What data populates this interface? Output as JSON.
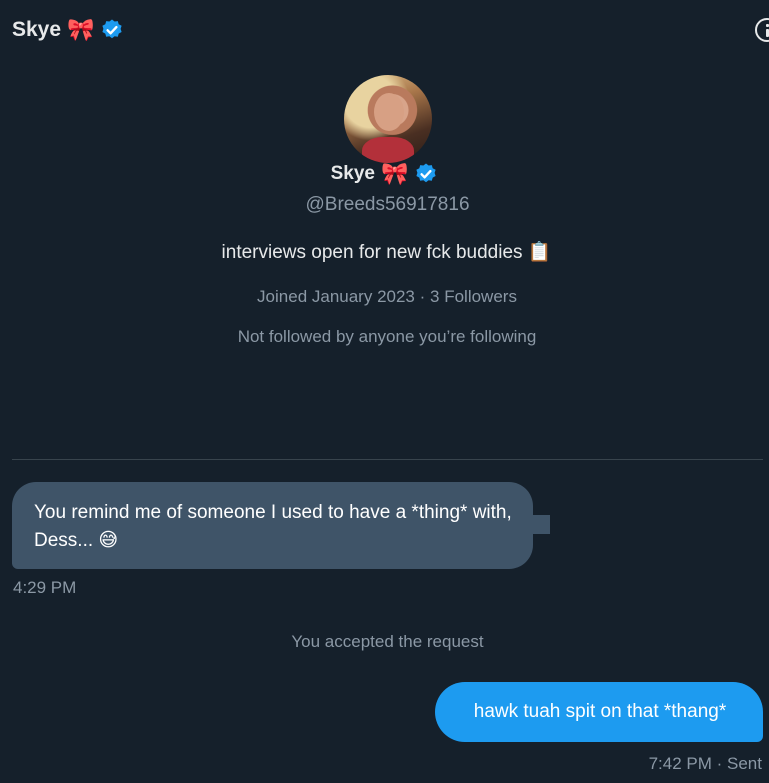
{
  "header": {
    "name": "Skye",
    "emoji": "🎀"
  },
  "profile": {
    "name": "Skye",
    "emoji": "🎀",
    "handle": "@Breeds56917816",
    "bio": "interviews open for new fck buddies 📋",
    "joined": "Joined January 2023",
    "separator": "·",
    "followers": "3 Followers",
    "followed_by": "Not followed by anyone you’re following"
  },
  "messages": {
    "incoming": {
      "text": "You remind me of someone I used to have a *thing* with, Dess... 😅",
      "time": "4:29 PM"
    },
    "system": "You accepted the request",
    "outgoing": {
      "text": "hawk tuah spit on that *thang*",
      "time": "7:42 PM",
      "separator": "·",
      "status": "Sent"
    }
  },
  "colors": {
    "background": "#15202b",
    "accent": "#1d9bf0",
    "incoming_bubble": "#3f5468",
    "muted_text": "#8b98a5",
    "divider": "#38444d"
  },
  "icons": {
    "verified": "verified-badge-icon",
    "info": "info-icon"
  }
}
